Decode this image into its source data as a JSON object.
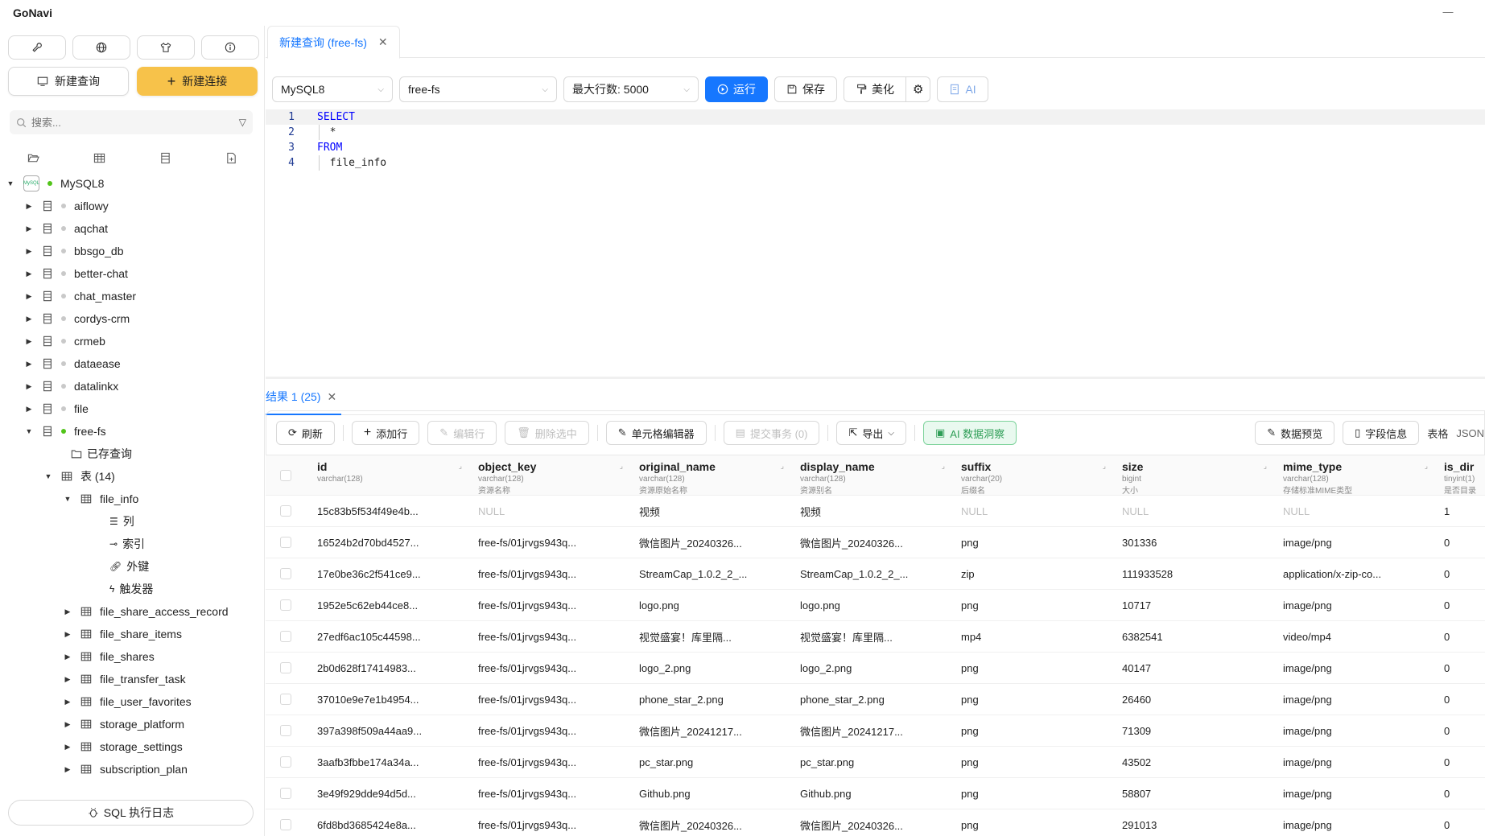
{
  "app": {
    "title": "GoNavi",
    "minimize_icon": "—"
  },
  "sidebar": {
    "new_query_label": "新建查询",
    "new_connection_label": "新建连接",
    "search_placeholder": "搜索...",
    "filter_icon": "▽",
    "connection": {
      "name": "MySQL8",
      "logo_text": "MySQL"
    },
    "databases": [
      {
        "name": "aiflowy"
      },
      {
        "name": "aqchat"
      },
      {
        "name": "bbsgo_db"
      },
      {
        "name": "better-chat"
      },
      {
        "name": "chat_master"
      },
      {
        "name": "cordys-crm"
      },
      {
        "name": "crmeb"
      },
      {
        "name": "dataease"
      },
      {
        "name": "datalinkx"
      },
      {
        "name": "file"
      },
      {
        "name": "free-fs"
      }
    ],
    "saved_queries_label": "已存查询",
    "tables_label": "表 (14)",
    "expanded_table": "file_info",
    "table_children": [
      "列",
      "索引",
      "外键",
      "触发器"
    ],
    "tables": [
      "file_share_access_record",
      "file_share_items",
      "file_shares",
      "file_transfer_task",
      "file_user_favorites",
      "storage_platform",
      "storage_settings",
      "subscription_plan"
    ],
    "sql_log_label": "SQL 执行日志"
  },
  "editor_tab": {
    "label": "新建查询 (free-fs)",
    "close": "✕"
  },
  "toolbar": {
    "connection_value": "MySQL8",
    "database_value": "free-fs",
    "max_rows_value": "最大行数: 5000",
    "run_label": "运行",
    "save_label": "保存",
    "beautify_label": "美化",
    "ai_label": "AI"
  },
  "editor": {
    "lines": [
      {
        "num": "1",
        "text": "SELECT"
      },
      {
        "num": "2",
        "text": "  *"
      },
      {
        "num": "3",
        "text": "FROM"
      },
      {
        "num": "4",
        "text": "  file_info"
      }
    ]
  },
  "result": {
    "tab_label": "结果 1 (25)",
    "tab_close": "✕",
    "refresh_label": "刷新",
    "add_row_label": "添加行",
    "edit_row_label": "编辑行",
    "delete_selected_label": "删除选中",
    "cell_editor_label": "单元格编辑器",
    "commit_label": "提交事务 (0)",
    "export_label": "导出",
    "ai_insight_label": "AI 数据洞察",
    "data_preview_label": "数据预览",
    "field_info_label": "字段信息",
    "table_view_label": "表格",
    "json_view_label": "JSON",
    "columns": [
      {
        "name": "id",
        "type": "varchar(128)",
        "comment": ""
      },
      {
        "name": "object_key",
        "type": "varchar(128)",
        "comment": "资源名称"
      },
      {
        "name": "original_name",
        "type": "varchar(128)",
        "comment": "资源原始名称"
      },
      {
        "name": "display_name",
        "type": "varchar(128)",
        "comment": "资源别名"
      },
      {
        "name": "suffix",
        "type": "varchar(20)",
        "comment": "后缀名"
      },
      {
        "name": "size",
        "type": "bigint",
        "comment": "大小"
      },
      {
        "name": "mime_type",
        "type": "varchar(128)",
        "comment": "存储标准MIME类型"
      },
      {
        "name": "is_dir",
        "type": "tinyint(1)",
        "comment": "是否目录"
      }
    ],
    "rows": [
      [
        "15c83b5f534f49e4b...",
        "NULL",
        "视频",
        "视频",
        "NULL",
        "NULL",
        "NULL",
        "1"
      ],
      [
        "16524b2d70bd4527...",
        "free-fs/01jrvgs943q...",
        "微信图片_20240326...",
        "微信图片_20240326...",
        "png",
        "301336",
        "image/png",
        "0"
      ],
      [
        "17e0be36c2f541ce9...",
        "free-fs/01jrvgs943q...",
        "StreamCap_1.0.2_2_...",
        "StreamCap_1.0.2_2_...",
        "zip",
        "111933528",
        "application/x-zip-co...",
        "0"
      ],
      [
        "1952e5c62eb44ce8...",
        "free-fs/01jrvgs943q...",
        "logo.png",
        "logo.png",
        "png",
        "10717",
        "image/png",
        "0"
      ],
      [
        "27edf6ac105c44598...",
        "free-fs/01jrvgs943q...",
        "视觉盛宴！库里隔...",
        "视觉盛宴！库里隔...",
        "mp4",
        "6382541",
        "video/mp4",
        "0"
      ],
      [
        "2b0d628f17414983...",
        "free-fs/01jrvgs943q...",
        "logo_2.png",
        "logo_2.png",
        "png",
        "40147",
        "image/png",
        "0"
      ],
      [
        "37010e9e7e1b4954...",
        "free-fs/01jrvgs943q...",
        "phone_star_2.png",
        "phone_star_2.png",
        "png",
        "26460",
        "image/png",
        "0"
      ],
      [
        "397a398f509a44aa9...",
        "free-fs/01jrvgs943q...",
        "微信图片_20241217...",
        "微信图片_20241217...",
        "png",
        "71309",
        "image/png",
        "0"
      ],
      [
        "3aafb3fbbe174a34a...",
        "free-fs/01jrvgs943q...",
        "pc_star.png",
        "pc_star.png",
        "png",
        "43502",
        "image/png",
        "0"
      ],
      [
        "3e49f929dde94d5d...",
        "free-fs/01jrvgs943q...",
        "Github.png",
        "Github.png",
        "png",
        "58807",
        "image/png",
        "0"
      ],
      [
        "6fd8bd3685424e8a...",
        "free-fs/01jrvgs943q...",
        "微信图片_20240326...",
        "微信图片_20240326...",
        "png",
        "291013",
        "image/png",
        "0"
      ]
    ]
  },
  "colors": {
    "primary": "#1677ff",
    "accent_yellow": "#f7c24a",
    "status_green": "#52c41a"
  }
}
